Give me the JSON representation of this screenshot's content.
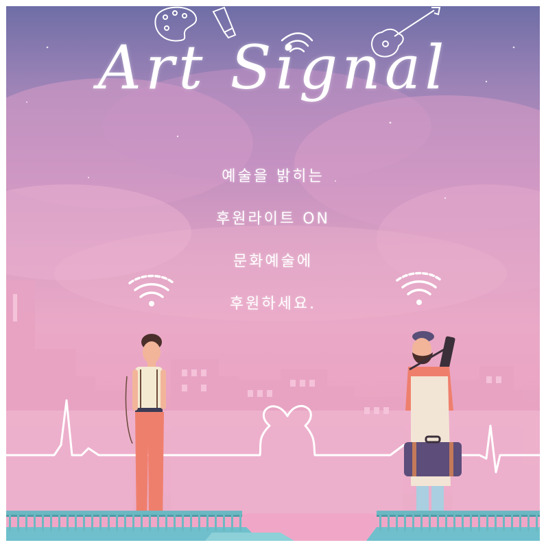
{
  "poster": {
    "title": "Art Signal",
    "tagline": [
      "예술을 밝히는",
      "후원라이트 ON",
      "문화예술에",
      "후원하세요."
    ],
    "icons": [
      "palette-icon",
      "paint-tube-icon",
      "guitar-icon",
      "wifi-signal-icon",
      "heartbeat-line-icon",
      "heart-icon"
    ],
    "colors": {
      "sky_top": "#6f6ea6",
      "sky_mid": "#c190bf",
      "sky_bottom": "#de94b6",
      "buildings": "#e59bbd",
      "fence": "#6cb8c2",
      "ground": "#6fc0cc",
      "line": "#ffffff",
      "pants_left": "#ef7f6d",
      "apron_right": "#f3e5d5"
    },
    "scene": {
      "left_figure": "young-man-standing",
      "right_figure": "bearded-artist-with-suitcase"
    }
  }
}
